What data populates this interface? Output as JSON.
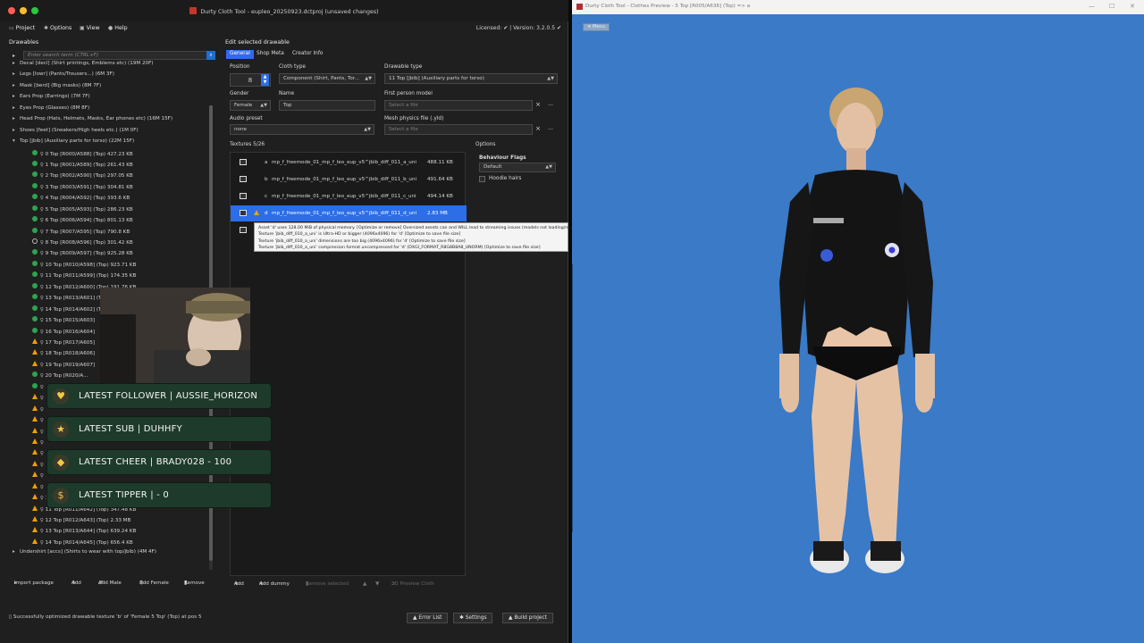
{
  "left_window": {
    "title": "Durty Cloth Tool - eupleo_20250923.dctproj (unsaved changes)",
    "menu": [
      "Project",
      "Options",
      "View",
      "Help"
    ],
    "license": "Licensed: ✔ | Version: 3.2.0.5 ✔",
    "drawables_title": "Drawables",
    "search_placeholder": "Enter search term (CTRL+F)",
    "tree": [
      {
        "exp": "▸",
        "text": "Decal [decl] (Shirt printings, Emblems etc) (19M 20F)",
        "icon": "",
        "indent": 0
      },
      {
        "exp": "▸",
        "text": "Legs [lowr] (Pants/Trousers...) (6M 3F)",
        "icon": "",
        "indent": 0
      },
      {
        "exp": "▸",
        "text": "Mask [berd] (Big masks) (8M 7F)",
        "icon": "",
        "indent": 0
      },
      {
        "exp": "▸",
        "text": "Ears Prop (Earrings) (7M 7F)",
        "icon": "",
        "indent": 0
      },
      {
        "exp": "▸",
        "text": "Eyes Prop (Glasses) (8M 8F)",
        "icon": "",
        "indent": 0
      },
      {
        "exp": "▸",
        "text": "Head Prop (Hats, Helmets, Masks, Ear phones etc) (16M 15F)",
        "icon": "",
        "indent": 0
      },
      {
        "exp": "▸",
        "text": "Shoes [feet] (Sneakers/High heels etc.) (1M 0F)",
        "icon": "",
        "indent": 0
      },
      {
        "exp": "▾",
        "text": "Top [jbib] (Auxiliary parts for torso) (22M 15F)",
        "icon": "",
        "indent": 0
      },
      {
        "exp": "",
        "text": "0 Top [R000/A588] (Top) 427.23 KB",
        "icon": "green",
        "indent": 1
      },
      {
        "exp": "",
        "text": "1 Top [R001/A589] (Top) 261.43 KB",
        "icon": "green",
        "indent": 1
      },
      {
        "exp": "",
        "text": "2 Top [R002/A590] (Top) 297.05 KB",
        "icon": "green",
        "indent": 1
      },
      {
        "exp": "",
        "text": "3 Top [R003/A591] (Top) 304.81 KB",
        "icon": "green",
        "indent": 1
      },
      {
        "exp": "",
        "text": "4 Top [R004/A592] (Top) 393.6 KB",
        "icon": "green",
        "indent": 1
      },
      {
        "exp": "",
        "text": "5 Top [R005/A593] (Top) 286.23 KB",
        "icon": "green",
        "indent": 1
      },
      {
        "exp": "",
        "text": "6 Top [R006/A594] (Top) 801.13 KB",
        "icon": "green",
        "indent": 1
      },
      {
        "exp": "",
        "text": "7 Top [R007/A595] (Top) 790.8 KB",
        "icon": "green",
        "indent": 1
      },
      {
        "exp": "",
        "text": "8 Top [R008/A596] (Top) 301.42 KB",
        "icon": "ring",
        "indent": 1
      },
      {
        "exp": "",
        "text": "9 Top [R009/A597] (Top) 925.28 KB",
        "icon": "green",
        "indent": 1
      },
      {
        "exp": "",
        "text": "10 Top [R010/A598] (Top) 923.71 KB",
        "icon": "green",
        "indent": 1
      },
      {
        "exp": "",
        "text": "11 Top [R011/A599] (Top) 174.35 KB",
        "icon": "green",
        "indent": 1
      },
      {
        "exp": "",
        "text": "12 Top [R012/A600] (Top) 191.76 KB",
        "icon": "green",
        "indent": 1
      },
      {
        "exp": "",
        "text": "13 Top [R013/A601] (Top) 324.13 KB",
        "icon": "green",
        "indent": 1
      },
      {
        "exp": "",
        "text": "14 Top [R014/A602] (Top) 341.43 KB",
        "icon": "green",
        "indent": 1
      },
      {
        "exp": "",
        "text": "15 Top [R015/A603]",
        "icon": "green",
        "indent": 1
      },
      {
        "exp": "",
        "text": "16 Top [R016/A604]",
        "icon": "green",
        "indent": 1
      },
      {
        "exp": "",
        "text": "17 Top [R017/A605]",
        "icon": "warn",
        "indent": 1
      },
      {
        "exp": "",
        "text": "18 Top [R018/A606]",
        "icon": "warn",
        "indent": 1
      },
      {
        "exp": "",
        "text": "19 Top [R019/A607]",
        "icon": "warn",
        "indent": 1
      },
      {
        "exp": "",
        "text": "20 Top [R020/A...",
        "icon": "green",
        "indent": 1
      },
      {
        "exp": "",
        "text": "",
        "icon": "green",
        "indent": 1
      },
      {
        "exp": "",
        "text": "",
        "icon": "warn",
        "indent": 1
      },
      {
        "exp": "",
        "text": "",
        "icon": "warn",
        "indent": 1
      },
      {
        "exp": "",
        "text": "",
        "icon": "warn",
        "indent": 1
      },
      {
        "exp": "",
        "text": "",
        "icon": "warn",
        "indent": 1
      },
      {
        "exp": "",
        "text": "",
        "icon": "warn",
        "indent": 1
      },
      {
        "exp": "",
        "text": "",
        "icon": "warn",
        "indent": 1
      },
      {
        "exp": "",
        "text": "",
        "icon": "warn",
        "indent": 1
      },
      {
        "exp": "",
        "text": "",
        "icon": "warn",
        "indent": 1
      },
      {
        "exp": "",
        "text": "",
        "icon": "warn",
        "indent": 1
      },
      {
        "exp": "",
        "text": "10 Top [R010/A641] (Top) 329.33 KB",
        "icon": "warn",
        "indent": 1
      },
      {
        "exp": "",
        "text": "11 Top [R011/A642] (Top) 347.48 KB",
        "icon": "warn",
        "indent": 1
      },
      {
        "exp": "",
        "text": "12 Top [R012/A643] (Top) 2.33 MB",
        "icon": "warn",
        "indent": 1
      },
      {
        "exp": "",
        "text": "13 Top [R013/A644] (Top) 639.24 KB",
        "icon": "warn",
        "indent": 1
      },
      {
        "exp": "",
        "text": "14 Top [R014/A645] (Top) 656.4 KB",
        "icon": "warn",
        "indent": 1
      },
      {
        "exp": "▸",
        "text": "Undershirt [accs] (Shirts to wear with top/jbib) (4M 4F)",
        "icon": "",
        "indent": 0
      }
    ],
    "left_buttons": [
      "Import package",
      "Add",
      "Add Male",
      "Add Female",
      "Remove"
    ],
    "status": "Successfully optimized drawable texture 'b' of 'Female 5 Top' (Top) at pos 5",
    "status_buttons": [
      "Error List",
      "Settings",
      "Build project"
    ],
    "editor": {
      "title": "Edit selected drawable",
      "tabs": [
        "General",
        "Shop Meta",
        "Creator Info"
      ],
      "position_label": "Position",
      "position_value": "8",
      "cloth_type_label": "Cloth type",
      "cloth_type_value": "Component (Shirt, Pants, Tor...",
      "drawable_type_label": "Drawable type",
      "drawable_type_value": "11  Top [jbib] (Auxiliary parts for torso)",
      "gender_label": "Gender",
      "gender_value": "Female",
      "name_label": "Name",
      "name_value": "Top",
      "fp_model_label": "First person model",
      "fp_model_placeholder": "Select a file",
      "audio_label": "Audio preset",
      "audio_value": "none",
      "mesh_label": "Mesh physics file (.yld)",
      "mesh_placeholder": "Select a file",
      "textures_label": "Textures 5/26",
      "options_label": "Options",
      "behaviour_label": "Behaviour Flags",
      "behaviour_value": "Default",
      "hoodie_label": "Hoodie hairs",
      "textures": [
        {
          "letter": "a",
          "name": "mp_f_freemode_01_mp_f_leo_eup_v5^jbib_diff_011_a_uni",
          "size": "488.11 KB",
          "selected": false,
          "warn": false
        },
        {
          "letter": "b",
          "name": "mp_f_freemode_01_mp_f_leo_eup_v5^jbib_diff_011_b_uni",
          "size": "491.64 KB",
          "selected": false,
          "warn": false
        },
        {
          "letter": "c",
          "name": "mp_f_freemode_01_mp_f_leo_eup_v5^jbib_diff_011_c_uni",
          "size": "494.14 KB",
          "selected": false,
          "warn": false
        },
        {
          "letter": "d",
          "name": "mp_f_freemode_01_mp_f_leo_eup_v5^jbib_diff_011_d_uni",
          "size": "2.83 MB",
          "selected": true,
          "warn": true
        },
        {
          "letter": "",
          "name": "",
          "size": "",
          "selected": false,
          "warn": false
        }
      ],
      "tooltip": [
        "Asset 'd' uses 128.00 MiB of physical memory. [Optimize or remove] Oversized assets can and WILL lead to streaming issues (models not loading/rendering, commonly known as 'texture loss', 'city bug' or 'streaming isn't great')",
        "Texture 'jbib_diff_010_a_uni' is Ultra-HD or bigger (4096x4096) for 'd' [Optimize to save file size]",
        "Texture 'jbib_diff_010_a_uni' dimensions are too big (4096x4096) for 'd' [Optimize to save file size]",
        "Texture 'jbib_diff_010_a_uni' compression format uncompressed for 'd' (DXGI_FORMAT_R8G8B8A8_UNORM) [Optimize to save file size]"
      ],
      "tex_buttons": [
        "Add",
        "Add dummy",
        "Remove selected",
        "▲",
        "▼",
        "3D Preview Cloth"
      ]
    }
  },
  "overlay": {
    "alerts": [
      {
        "icon": "heart-icon",
        "glyph": "♥",
        "text": "LATEST FOLLOWER | AUSSIE_HORIZON"
      },
      {
        "icon": "star-icon",
        "glyph": "★",
        "text": "LATEST SUB | DUHHFY"
      },
      {
        "icon": "diamond-icon",
        "glyph": "◆",
        "text": "LATEST CHEER | BRADY028 - 100"
      },
      {
        "icon": "dollar-icon",
        "glyph": "$",
        "text": "LATEST TIPPER |  -  0"
      }
    ]
  },
  "right_window": {
    "title": "Durty Cloth Tool - Clothes Preview - 5 Top [R005/A636] (Top) => a",
    "menu_button": "≡ Menu",
    "background_color": "#3a7ac7"
  },
  "colors": {
    "accent": "#2b6ee8",
    "warning": "#f0a000",
    "ok": "#2ea44f"
  }
}
